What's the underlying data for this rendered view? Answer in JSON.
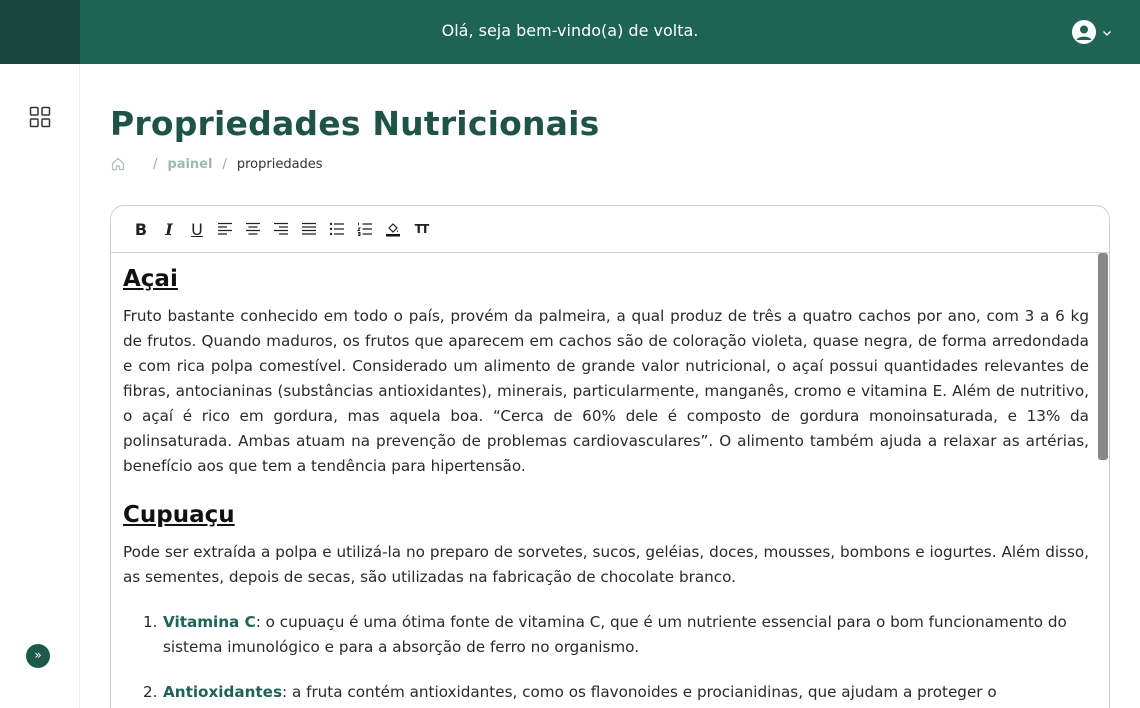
{
  "header": {
    "welcome": "Olá, seja bem-vindo(a) de volta."
  },
  "breadcrumb": {
    "painel": "painel",
    "current": "propriedades"
  },
  "page": {
    "title": "Propriedades Nutricionais"
  },
  "sections": [
    {
      "heading": "Açai",
      "text": "Fruto bastante conhecido em todo o país, provém da palmeira, a qual produz de três a quatro cachos por ano, com 3 a 6 kg de frutos. Quando maduros, os frutos que aparecem em cachos são de coloração violeta, quase negra, de forma arredondada e com rica polpa comestível. Considerado um alimento de grande valor nutricional, o açaí possui quantidades relevantes de fibras, antocianinas (substâncias antioxidantes), minerais, particularmente, manganês, cromo e vitamina E. Além de nutritivo, o açaí é rico em gordura, mas aquela boa. “Cerca de 60% dele é composto de gordura monoinsaturada, e 13% da polinsaturada. Ambas atuam na prevenção de problemas cardiovasculares”. O alimento também ajuda a relaxar as artérias, benefício aos que tem a tendência para hipertensão."
    },
    {
      "heading": "Cupuaçu",
      "text": "Pode ser extraída a polpa e utilizá-la no preparo de sorvetes, sucos, geléias, doces, mousses, bombons e iogurtes. Além disso, as sementes, depois de secas, são utilizadas na fabricação de chocolate branco."
    }
  ],
  "list": [
    {
      "num": "1.",
      "term": "Vitamina C",
      "text": ": o cupuaçu é uma ótima fonte de vitamina C, que é um nutriente essencial para o bom funcionamento do sistema imunológico e para a absorção de ferro no organismo."
    },
    {
      "num": "2.",
      "term": "Antioxidantes",
      "text": ": a fruta contém antioxidantes, como os flavonoides e procianidinas, que ajudam a proteger o"
    }
  ],
  "toolbar": {
    "bold": "B",
    "italic": "I",
    "underline": "U",
    "font_size": "TT"
  },
  "sidebar": {
    "expand": "»"
  },
  "colors": {
    "header_bg": "#1e6455",
    "header_corner": "#19473d",
    "title": "#1d5446",
    "accent": "#1e6455"
  }
}
